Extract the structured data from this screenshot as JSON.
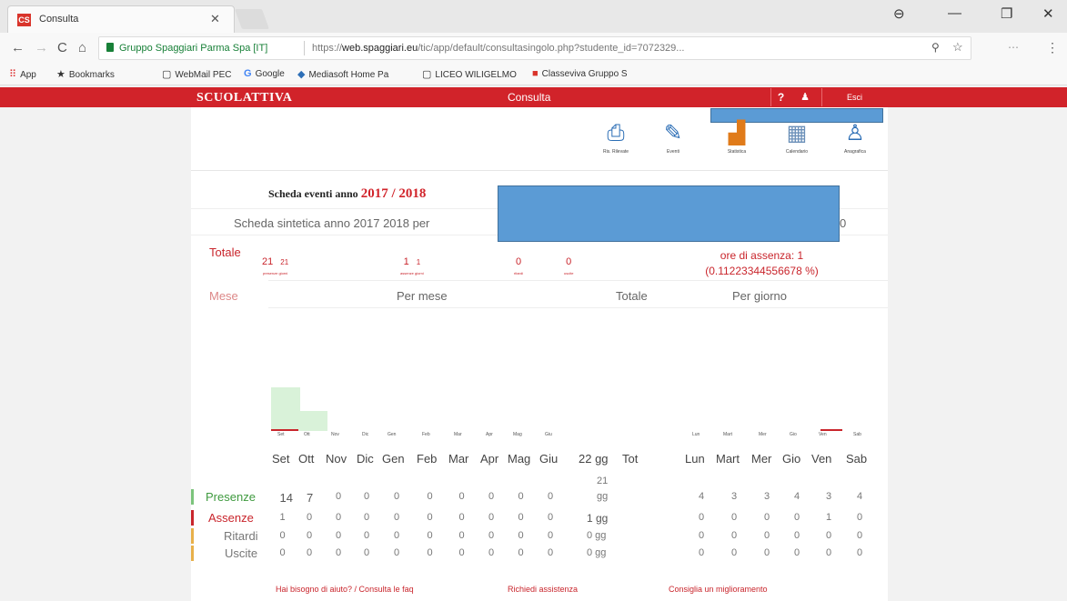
{
  "browser": {
    "tab_title": "Consulta",
    "tab_favicon": "CS",
    "secure_label": "Gruppo Spaggiari Parma Spa [IT]",
    "url_prefix": "https://",
    "url_domain": "web.spaggiari.eu",
    "url_path": "/tic/app/default/consultasingolo.php?studente_id=7072329...",
    "bookmarks": [
      "App",
      "Bookmarks",
      "WebMail PEC",
      "Google",
      "Mediasoft Home Pa",
      "LICEO WILIGELMO",
      "Classeviva Gruppo S"
    ]
  },
  "header": {
    "logo": "SCUOLATTIVA",
    "title": "Consulta",
    "help": "?",
    "exit": "Esci"
  },
  "toolbar": [
    {
      "label": "Ris. Rilevate",
      "icon": "printer-icon"
    },
    {
      "label": "Eventi",
      "icon": "edit-icon"
    },
    {
      "label": "Statistica",
      "icon": "chart-icon"
    },
    {
      "label": "Calendario",
      "icon": "calendar-icon"
    },
    {
      "label": "Anagrafica",
      "icon": "user-icon"
    }
  ],
  "scheda": {
    "title_prefix": "Scheda eventi anno",
    "year": "2017 / 2018",
    "sintetica": "Scheda sintetica anno 2017 2018 per",
    "sintetica_end": "0"
  },
  "totale": {
    "label": "Totale",
    "presenze": "21",
    "presenze_giorni": "21",
    "presenze_caption": "presenze   giorni",
    "assenze": "1",
    "assenze_giorni": "1",
    "assenze_caption": "assenze   giorni",
    "ritardi": "0",
    "ritardi_caption": "ritardi",
    "uscite": "0",
    "uscite_caption": "uscite",
    "ore_assenza": "ore di assenza: 1",
    "ore_pct": "(0.11223344556678 %)"
  },
  "headers": {
    "mese": "Mese",
    "per_mese": "Per mese",
    "totale": "Totale",
    "per_giorno": "Per giorno"
  },
  "months_small": [
    "Set",
    "Ott",
    "Nov",
    "Dic",
    "Gen",
    "Feb",
    "Mar",
    "Apr",
    "Mag",
    "Giu"
  ],
  "days_small": [
    "Lun",
    "Mart",
    "Mer",
    "Gio",
    "Ven",
    "Sab"
  ],
  "months": [
    "Set",
    "Ott",
    "Nov",
    "Dic",
    "Gen",
    "Feb",
    "Mar",
    "Apr",
    "Mag",
    "Giu"
  ],
  "totals_header": "22 gg",
  "tot_label": "Tot",
  "days": [
    "Lun",
    "Mart",
    "Mer",
    "Gio",
    "Ven",
    "Sab"
  ],
  "rows": [
    {
      "label": "Presenze",
      "color": "#7cc47c",
      "months": [
        "14",
        "7",
        "0",
        "0",
        "0",
        "0",
        "0",
        "0",
        "0",
        "0"
      ],
      "total_top": "21",
      "total": "gg",
      "days": [
        "4",
        "3",
        "3",
        "4",
        "3",
        "4"
      ]
    },
    {
      "label": "Assenze",
      "color": "#c9252c",
      "months": [
        "1",
        "0",
        "0",
        "0",
        "0",
        "0",
        "0",
        "0",
        "0",
        "0"
      ],
      "total": "1 gg",
      "days": [
        "0",
        "0",
        "0",
        "0",
        "1",
        "0"
      ]
    },
    {
      "label": "Ritardi",
      "color": "#e8b04a",
      "months": [
        "0",
        "0",
        "0",
        "0",
        "0",
        "0",
        "0",
        "0",
        "0",
        "0"
      ],
      "total": "0 gg",
      "days": [
        "0",
        "0",
        "0",
        "0",
        "0",
        "0"
      ]
    },
    {
      "label": "Uscite",
      "color": "#e8b04a",
      "months": [
        "0",
        "0",
        "0",
        "0",
        "0",
        "0",
        "0",
        "0",
        "0",
        "0"
      ],
      "total": "0 gg",
      "days": [
        "0",
        "0",
        "0",
        "0",
        "0",
        "0"
      ]
    }
  ],
  "footer": {
    "faq": "Hai bisogno di aiuto? / Consulta le faq",
    "assistenza": "Richiedi assistenza",
    "miglioramento": "Consiglia un miglioramento"
  }
}
